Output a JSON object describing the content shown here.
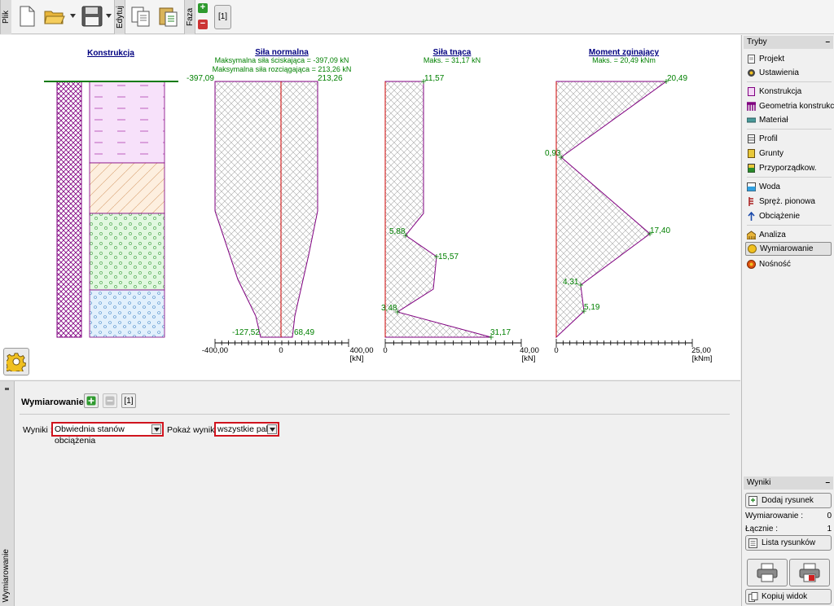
{
  "toolbar": {
    "file_label": "Plik",
    "edit_label": "Edytuj",
    "phase_label": "Faza",
    "phase_tab": "[1]"
  },
  "drawing": {
    "construction": {
      "title": "Konstrukcja"
    },
    "normal": {
      "title": "Siła normalna",
      "sub1": "Maksymalna siła ściskająca = -397,09 kN",
      "sub2": "Maksymalna siła rozciągająca = 213,26 kN",
      "top_left": "-397,09",
      "top_right": "213,26",
      "bottom_left": "-127,52",
      "bottom_right": "68,49",
      "axis_min": "-400,00",
      "axis_zero": "0",
      "axis_max": "400,00",
      "unit": "[kN]"
    },
    "shear": {
      "title": "Siła tnąca",
      "sub": "Maks. = 31,17 kN",
      "values": [
        "11,57",
        "5,88",
        "15,57",
        "3,48",
        "31,17"
      ],
      "axis_min": "0",
      "axis_max": "40,00",
      "unit": "[kN]"
    },
    "moment": {
      "title": "Moment zginający",
      "sub": "Maks. = 20,49 kNm",
      "values": [
        "20,49",
        "0,93",
        "17,40",
        "4,31",
        "5,19"
      ],
      "axis_min": "0",
      "axis_max": "25,00",
      "unit": "[kNm]"
    },
    "colors": {
      "title": "#000080",
      "values": "#008000",
      "diagram": "#800080",
      "axis": "#cc0000"
    }
  },
  "lower": {
    "side_label": "Wymiarowanie",
    "title": "Wymiarowanie :",
    "tab": "[1]",
    "results_label": "Wyniki :",
    "results_value": "Obwiednia stanów obciążenia",
    "show_label": "Pokaż wyniki :",
    "show_value": "wszystkie pale"
  },
  "modes": {
    "title": "Tryby",
    "items": [
      "Projekt",
      "Ustawienia",
      "Konstrukcja",
      "Geometria konstrukcji",
      "Materiał",
      "Profil",
      "Grunty",
      "Przyporządkow.",
      "Woda",
      "Spręż. pionowa",
      "Obciążenie",
      "Analiza",
      "Wymiarowanie",
      "Nośność"
    ],
    "selected": "Wymiarowanie"
  },
  "results": {
    "title": "Wyniki",
    "add_label": "Dodaj rysunek",
    "dim_label": "Wymiarowanie :",
    "dim_count": "0",
    "total_label": "Łącznie :",
    "total_count": "1",
    "list_label": "Lista rysunków",
    "copy_label": "Kopiuj widok"
  }
}
